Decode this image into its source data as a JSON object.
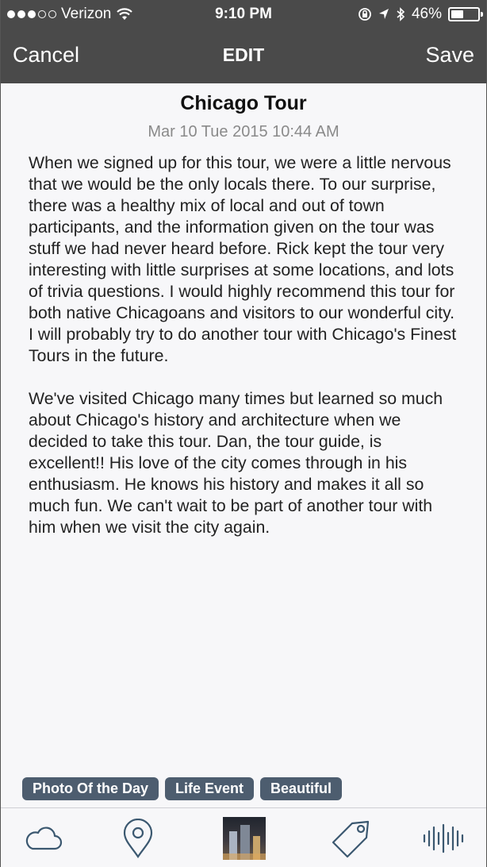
{
  "status_bar": {
    "carrier": "Verizon",
    "time": "9:10 PM",
    "battery": "46%",
    "battery_level": 0.46,
    "signal_bars_filled": 3,
    "signal_bars_total": 5
  },
  "nav": {
    "cancel_label": "Cancel",
    "title": "EDIT",
    "save_label": "Save"
  },
  "entry": {
    "title": "Chicago Tour",
    "date": "Mar 10 Tue 2015 10:44 AM",
    "paragraphs": [
      "When we signed up for this tour, we were a little nervous that we would be the only locals there. To our surprise, there was a healthy mix of local and out of town participants, and the information given on the tour was stuff we had never heard before. Rick kept the tour very interesting with little surprises at some locations, and lots of trivia questions. I would highly recommend this tour for both native Chicagoans and visitors to our wonderful city. I will probably try to do another tour with Chicago's Finest Tours in the future.",
      "We've visited Chicago many times but learned so much about Chicago's history and architecture when we decided to take this tour. Dan, the tour guide, is excellent!! His love of the city comes through in his enthusiasm. He knows his history and makes it all so much fun. We can't wait to be part of another tour with him when we visit the city again."
    ]
  },
  "tags": [
    "Photo Of the Day",
    "Life Event",
    "Beautiful"
  ],
  "toolbar": {
    "icons": [
      "cloud-icon",
      "location-pin-icon",
      "photo-thumbnail",
      "tag-icon",
      "audio-waveform-icon"
    ]
  },
  "colors": {
    "header_bg": "#4a4a4a",
    "tag_bg": "#4d5d6f",
    "toolbar_icon": "#3b5870"
  }
}
